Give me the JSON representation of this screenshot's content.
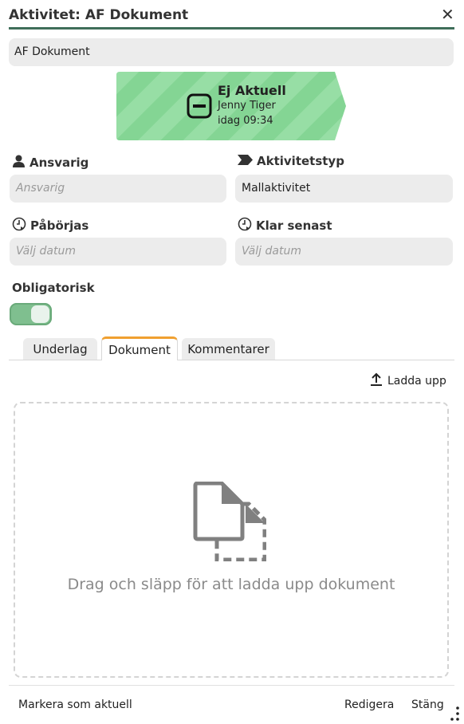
{
  "dialog": {
    "title": "Aktivitet: AF Dokument",
    "close_icon": "close-icon",
    "name_value": "AF Dokument"
  },
  "status": {
    "title": "Ej Aktuell",
    "user": "Jenny Tiger",
    "time": "idag 09:34",
    "color": "#7cd48e",
    "icon": "minus-square-icon"
  },
  "fields": {
    "ansvarig": {
      "label": "Ansvarig",
      "placeholder": "Ansvarig",
      "icon": "user-icon"
    },
    "aktivitetstyp": {
      "label": "Aktivitetstyp",
      "value": "Mallaktivitet",
      "icon": "tag-icon"
    },
    "paborjas": {
      "label": "Påbörjas",
      "placeholder": "Välj datum",
      "icon": "clock-icon"
    },
    "klar_senast": {
      "label": "Klar senast",
      "placeholder": "Välj datum",
      "icon": "clock-icon"
    }
  },
  "obligatorisk": {
    "label": "Obligatorisk",
    "checked": true
  },
  "tabs": [
    {
      "label": "Underlag"
    },
    {
      "label": "Dokument",
      "active": true
    },
    {
      "label": "Kommentarer"
    }
  ],
  "upload": {
    "label": "Ladda upp",
    "icon": "upload-icon"
  },
  "dropzone": {
    "text": "Drag och släpp för att ladda upp dokument",
    "icon": "documents-icon"
  },
  "footer": {
    "mark_current": "Markera som aktuell",
    "edit": "Redigera",
    "close": "Stäng",
    "more_icon": "more-vertical-icon"
  }
}
